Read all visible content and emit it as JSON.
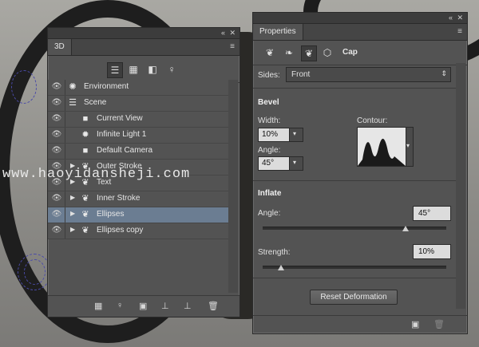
{
  "watermark": "www.haoyidansheji.com",
  "panel3d": {
    "tab": "3D",
    "top_controls": "«",
    "close": "✕",
    "menu": "≡",
    "toolbar": [
      "scene-filter",
      "mesh-filter",
      "material-filter",
      "light-filter"
    ],
    "layers": [
      {
        "label": "Environment",
        "icon": "environment-icon",
        "visible": true,
        "level": 0
      },
      {
        "label": "Scene",
        "icon": "scene-icon",
        "visible": true,
        "level": 0
      },
      {
        "label": "Current View",
        "icon": "camera-icon",
        "visible": true,
        "level": 1
      },
      {
        "label": "Infinite Light 1",
        "icon": "light-icon",
        "visible": true,
        "level": 1
      },
      {
        "label": "Default Camera",
        "icon": "camera-icon",
        "visible": true,
        "level": 1
      },
      {
        "label": "Outer Stroke",
        "icon": "mesh-icon",
        "visible": true,
        "level": 1,
        "expandable": true
      },
      {
        "label": "Text",
        "icon": "mesh-icon",
        "visible": true,
        "level": 1,
        "expandable": true
      },
      {
        "label": "Inner Stroke",
        "icon": "mesh-icon",
        "visible": true,
        "level": 1,
        "expandable": true
      },
      {
        "label": "Ellipses",
        "icon": "mesh-icon",
        "visible": true,
        "level": 1,
        "expandable": true,
        "selected": true
      },
      {
        "label": "Ellipses copy",
        "icon": "mesh-icon",
        "visible": true,
        "level": 1,
        "expandable": true
      }
    ]
  },
  "props": {
    "tab": "Properties",
    "cap_label": "Cap",
    "sides_label": "Sides:",
    "sides_value": "Front",
    "bevel_title": "Bevel",
    "width_label": "Width:",
    "width_value": "10%",
    "contour_label": "Contour:",
    "angle_label": "Angle:",
    "angle_value": "45°",
    "inflate_title": "Inflate",
    "inflate_angle_label": "Angle:",
    "inflate_angle_value": "45°",
    "inflate_angle_fraction": 0.78,
    "strength_label": "Strength:",
    "strength_value": "10%",
    "strength_fraction": 0.1,
    "reset_label": "Reset Deformation"
  }
}
